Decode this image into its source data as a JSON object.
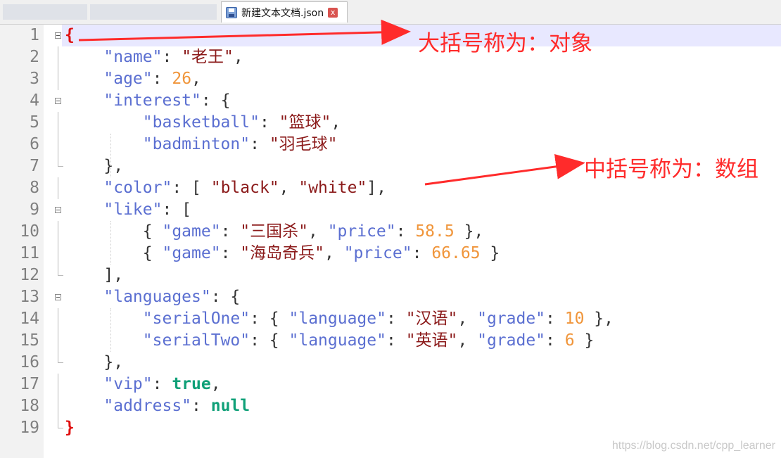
{
  "tab": {
    "filename": "新建文本文档.json",
    "close_glyph": "x"
  },
  "lines": [
    {
      "no": "1",
      "tokens": [
        [
          "brace-root",
          "{"
        ]
      ]
    },
    {
      "no": "2",
      "tokens": [
        [
          "p",
          "    "
        ],
        [
          "k",
          "\"name\""
        ],
        [
          "p",
          ": "
        ],
        [
          "s",
          "\"老王\""
        ],
        [
          "p",
          ","
        ]
      ]
    },
    {
      "no": "3",
      "tokens": [
        [
          "p",
          "    "
        ],
        [
          "k",
          "\"age\""
        ],
        [
          "p",
          ": "
        ],
        [
          "n",
          "26"
        ],
        [
          "p",
          ","
        ]
      ]
    },
    {
      "no": "4",
      "tokens": [
        [
          "p",
          "    "
        ],
        [
          "k",
          "\"interest\""
        ],
        [
          "p",
          ": {"
        ]
      ]
    },
    {
      "no": "5",
      "tokens": [
        [
          "p",
          "        "
        ],
        [
          "k",
          "\"basketball\""
        ],
        [
          "p",
          ": "
        ],
        [
          "s",
          "\"篮球\""
        ],
        [
          "p",
          ","
        ]
      ]
    },
    {
      "no": "6",
      "tokens": [
        [
          "p",
          "        "
        ],
        [
          "k",
          "\"badminton\""
        ],
        [
          "p",
          ": "
        ],
        [
          "s",
          "\"羽毛球\""
        ]
      ]
    },
    {
      "no": "7",
      "tokens": [
        [
          "p",
          "    },"
        ]
      ]
    },
    {
      "no": "8",
      "tokens": [
        [
          "p",
          "    "
        ],
        [
          "k",
          "\"color\""
        ],
        [
          "p",
          ": [ "
        ],
        [
          "s",
          "\"black\""
        ],
        [
          "p",
          ", "
        ],
        [
          "s",
          "\"white\""
        ],
        [
          "p",
          "],"
        ]
      ]
    },
    {
      "no": "9",
      "tokens": [
        [
          "p",
          "    "
        ],
        [
          "k",
          "\"like\""
        ],
        [
          "p",
          ": ["
        ]
      ]
    },
    {
      "no": "10",
      "tokens": [
        [
          "p",
          "        { "
        ],
        [
          "k",
          "\"game\""
        ],
        [
          "p",
          ": "
        ],
        [
          "s",
          "\"三国杀\""
        ],
        [
          "p",
          ", "
        ],
        [
          "k",
          "\"price\""
        ],
        [
          "p",
          ": "
        ],
        [
          "n",
          "58.5"
        ],
        [
          "p",
          " },"
        ]
      ]
    },
    {
      "no": "11",
      "tokens": [
        [
          "p",
          "        { "
        ],
        [
          "k",
          "\"game\""
        ],
        [
          "p",
          ": "
        ],
        [
          "s",
          "\"海岛奇兵\""
        ],
        [
          "p",
          ", "
        ],
        [
          "k",
          "\"price\""
        ],
        [
          "p",
          ": "
        ],
        [
          "n",
          "66.65"
        ],
        [
          "p",
          " }"
        ]
      ]
    },
    {
      "no": "12",
      "tokens": [
        [
          "p",
          "    ],"
        ]
      ]
    },
    {
      "no": "13",
      "tokens": [
        [
          "p",
          "    "
        ],
        [
          "k",
          "\"languages\""
        ],
        [
          "p",
          ": {"
        ]
      ]
    },
    {
      "no": "14",
      "tokens": [
        [
          "p",
          "        "
        ],
        [
          "k",
          "\"serialOne\""
        ],
        [
          "p",
          ": { "
        ],
        [
          "k",
          "\"language\""
        ],
        [
          "p",
          ": "
        ],
        [
          "s",
          "\"汉语\""
        ],
        [
          "p",
          ", "
        ],
        [
          "k",
          "\"grade\""
        ],
        [
          "p",
          ": "
        ],
        [
          "n",
          "10"
        ],
        [
          "p",
          " },"
        ]
      ]
    },
    {
      "no": "15",
      "tokens": [
        [
          "p",
          "        "
        ],
        [
          "k",
          "\"serialTwo\""
        ],
        [
          "p",
          ": { "
        ],
        [
          "k",
          "\"language\""
        ],
        [
          "p",
          ": "
        ],
        [
          "s",
          "\"英语\""
        ],
        [
          "p",
          ", "
        ],
        [
          "k",
          "\"grade\""
        ],
        [
          "p",
          ": "
        ],
        [
          "n",
          "6"
        ],
        [
          "p",
          " }"
        ]
      ]
    },
    {
      "no": "16",
      "tokens": [
        [
          "p",
          "    },"
        ]
      ]
    },
    {
      "no": "17",
      "tokens": [
        [
          "p",
          "    "
        ],
        [
          "k",
          "\"vip\""
        ],
        [
          "p",
          ": "
        ],
        [
          "b",
          "true"
        ],
        [
          "p",
          ","
        ]
      ]
    },
    {
      "no": "18",
      "tokens": [
        [
          "p",
          "    "
        ],
        [
          "k",
          "\"address\""
        ],
        [
          "p",
          ": "
        ],
        [
          "b",
          "null"
        ]
      ]
    },
    {
      "no": "19",
      "tokens": [
        [
          "brace-root",
          "}"
        ]
      ]
    }
  ],
  "fold_markers": {
    "open": [
      "1",
      "4",
      "9",
      "13"
    ],
    "end": [
      "7",
      "12",
      "16",
      "19"
    ]
  },
  "annotations": {
    "object_label": "大括号称为：对象",
    "array_label": "中括号称为：数组",
    "arrow_color": "#ff2b2b"
  },
  "watermark": "https://blog.csdn.net/cpp_learner",
  "colors": {
    "key": "#5b6fd1",
    "string": "#8b1a1a",
    "number": "#f0953a",
    "keyword": "#0fa078",
    "root_brace": "#e01010",
    "current_line": "#e8e8ff"
  }
}
